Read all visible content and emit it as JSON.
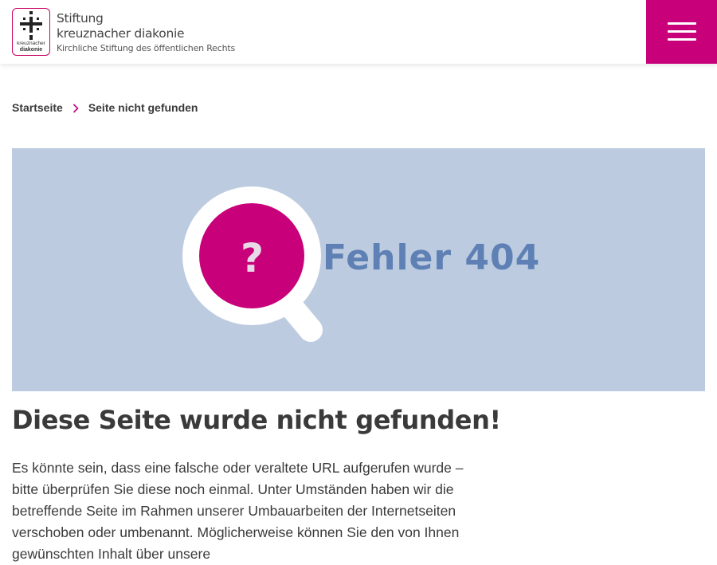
{
  "header": {
    "logo": {
      "line1": "Stiftung",
      "line2": "kreuznacher diakonie",
      "line3": "Kirchliche Stiftung des öffentlichen Rechts",
      "mark_small_1": "kreuznacher",
      "mark_small_2": "diakonie"
    },
    "menu_icon": "hamburger-icon"
  },
  "breadcrumb": {
    "home": "Startseite",
    "separator_icon": "chevron-right-icon",
    "current": "Seite nicht gefunden"
  },
  "error_image": {
    "question_mark": "?",
    "label": "Fehler 404",
    "icon": "magnifier-question-icon"
  },
  "content": {
    "title": "Diese Seite wurde nicht gefunden!",
    "paragraph": "Es könnte sein, dass eine falsche oder veraltete URL aufgerufen wurde – bitte überprüfen Sie diese noch einmal. Unter Umständen haben wir die betreffende Seite im Rahmen unserer Umbauarbeiten der Internetseiten verschoben oder umbenannt. Möglicherweise können Sie den von Ihnen gewünschten Inhalt über unsere"
  },
  "colors": {
    "brand_magenta": "#c8007a",
    "image_background": "#bccbe0",
    "label_blue": "#5e80b4"
  }
}
